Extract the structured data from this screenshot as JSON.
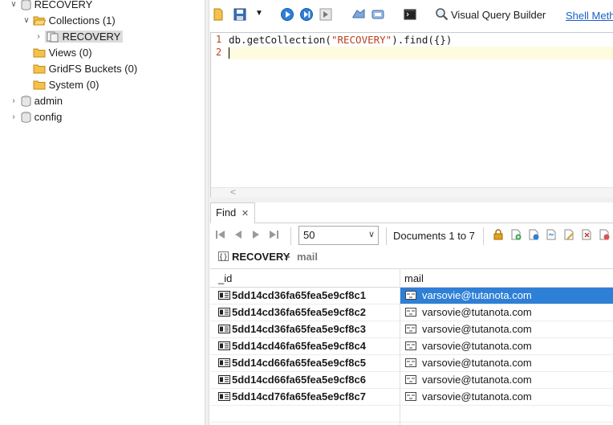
{
  "tree": {
    "root_label": "RECOVERY",
    "collections_label": "Collections (1)",
    "collection_item": "RECOVERY",
    "views_label": "Views (0)",
    "gridfs_label": "GridFS Buckets (0)",
    "system_label": "System (0)",
    "admin_label": "admin",
    "config_label": "config"
  },
  "toolbar": {
    "visual_query_builder": "Visual Query Builder",
    "shell_methods": "Shell Meth"
  },
  "editor": {
    "line1_number": "1",
    "line2_number": "2",
    "line1_prefix": "db.getCollection(",
    "line1_string": "\"RECOVERY\"",
    "line1_suffix": ").find({})",
    "hscroll_arrow": "<"
  },
  "find": {
    "tab_label": "Find",
    "page_size": "50",
    "documents_label": "Documents 1 to 7",
    "breadcrumb_collection": "RECOVERY",
    "breadcrumb_sep": ">",
    "breadcrumb_field": "mail"
  },
  "grid": {
    "columns": [
      "_id",
      "mail"
    ],
    "rows": [
      {
        "id": "5dd14cd36fa65fea5e9cf8c1",
        "mail": "varsovie@tutanota.com"
      },
      {
        "id": "5dd14cd36fa65fea5e9cf8c2",
        "mail": "varsovie@tutanota.com"
      },
      {
        "id": "5dd14cd36fa65fea5e9cf8c3",
        "mail": "varsovie@tutanota.com"
      },
      {
        "id": "5dd14cd46fa65fea5e9cf8c4",
        "mail": "varsovie@tutanota.com"
      },
      {
        "id": "5dd14cd66fa65fea5e9cf8c5",
        "mail": "varsovie@tutanota.com"
      },
      {
        "id": "5dd14cd66fa65fea5e9cf8c6",
        "mail": "varsovie@tutanota.com"
      },
      {
        "id": "5dd14cd76fa65fea5e9cf8c7",
        "mail": "varsovie@tutanota.com"
      }
    ],
    "selected_row": 0
  },
  "colors": {
    "selection": "#2e7fd6",
    "link": "#1a5fc9",
    "string": "#b8401f",
    "current_line": "#fffbe0"
  }
}
